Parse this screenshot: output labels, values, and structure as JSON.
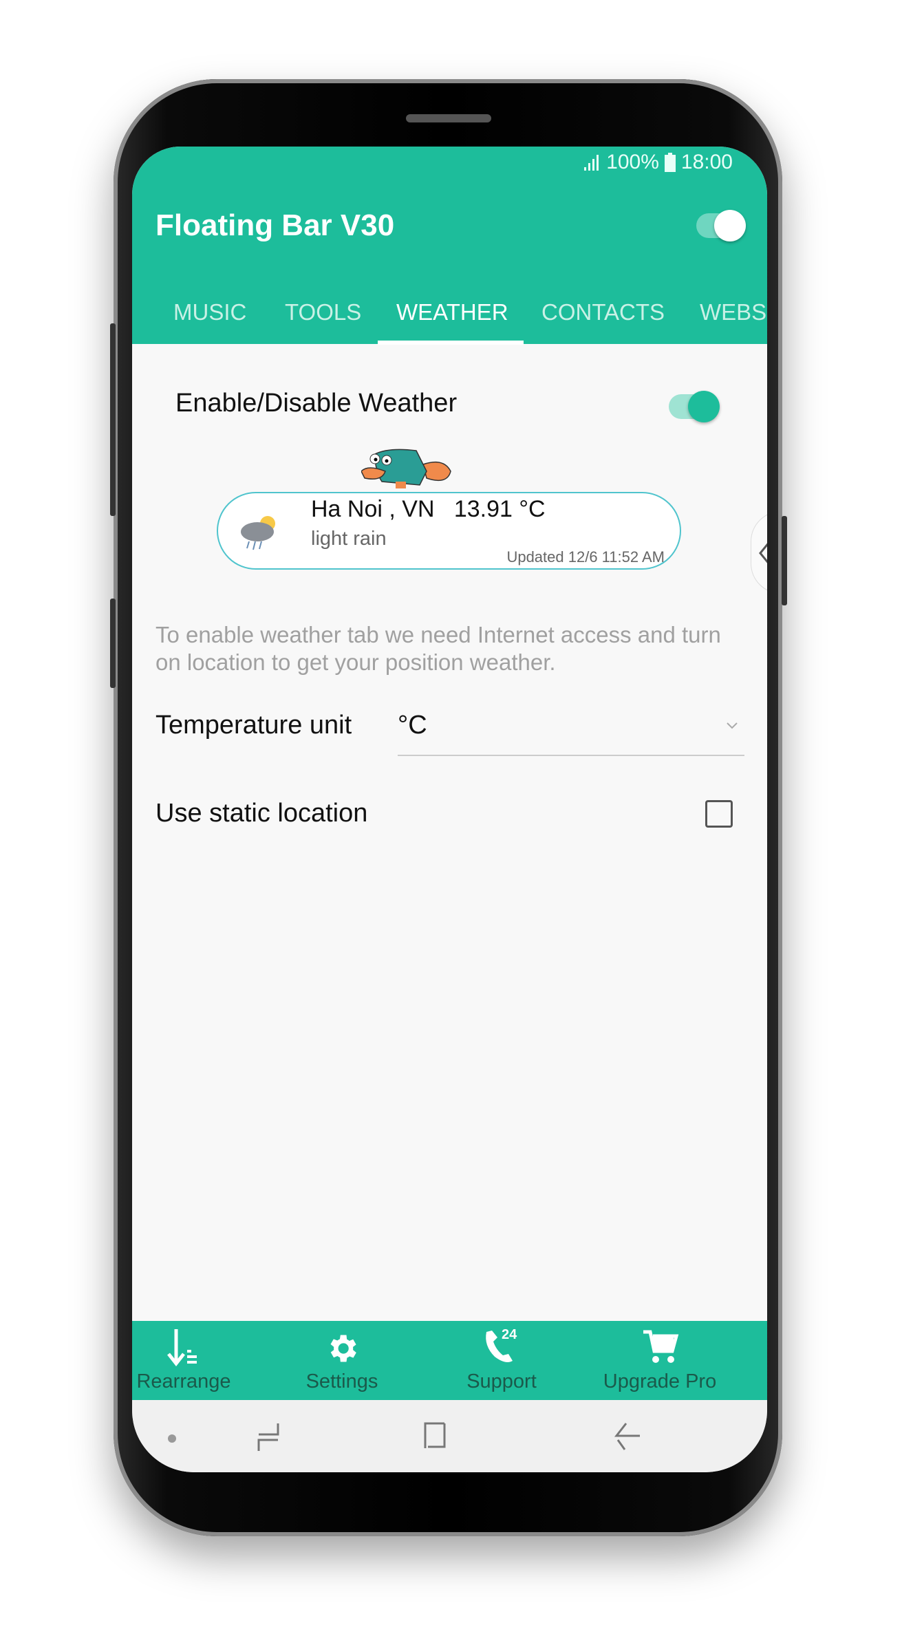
{
  "status": {
    "signal_icon": "signal-icon",
    "battery_level": "100%",
    "battery_icon": "battery-icon",
    "time": "18:00"
  },
  "app": {
    "title": "Floating Bar V30",
    "master_toggle": true,
    "accent": "#1dbd9b"
  },
  "tabs": [
    {
      "label": "MUSIC"
    },
    {
      "label": "TOOLS"
    },
    {
      "label": "WEATHER",
      "active": true
    },
    {
      "label": "CONTACTS"
    },
    {
      "label": "WEBSI"
    }
  ],
  "weather": {
    "enable_label": "Enable/Disable Weather",
    "enabled": true,
    "location": "Ha Noi , VN",
    "temperature": "13.91 °C",
    "condition": "light rain",
    "updated": "Updated 12/6 11:52 AM",
    "description": "To enable weather tab we need Internet access and turn on location to get your position weather.",
    "unit_label": "Temperature unit",
    "unit_value": "°C",
    "static_location_label": "Use static location",
    "static_location": false
  },
  "bottom_bar": [
    {
      "label": "Rearrange",
      "icon": "rearrange-icon"
    },
    {
      "label": "Settings",
      "icon": "gear-icon"
    },
    {
      "label": "Support",
      "icon": "phone-24-icon"
    },
    {
      "label": "Upgrade Pro",
      "icon": "cart-icon"
    }
  ]
}
